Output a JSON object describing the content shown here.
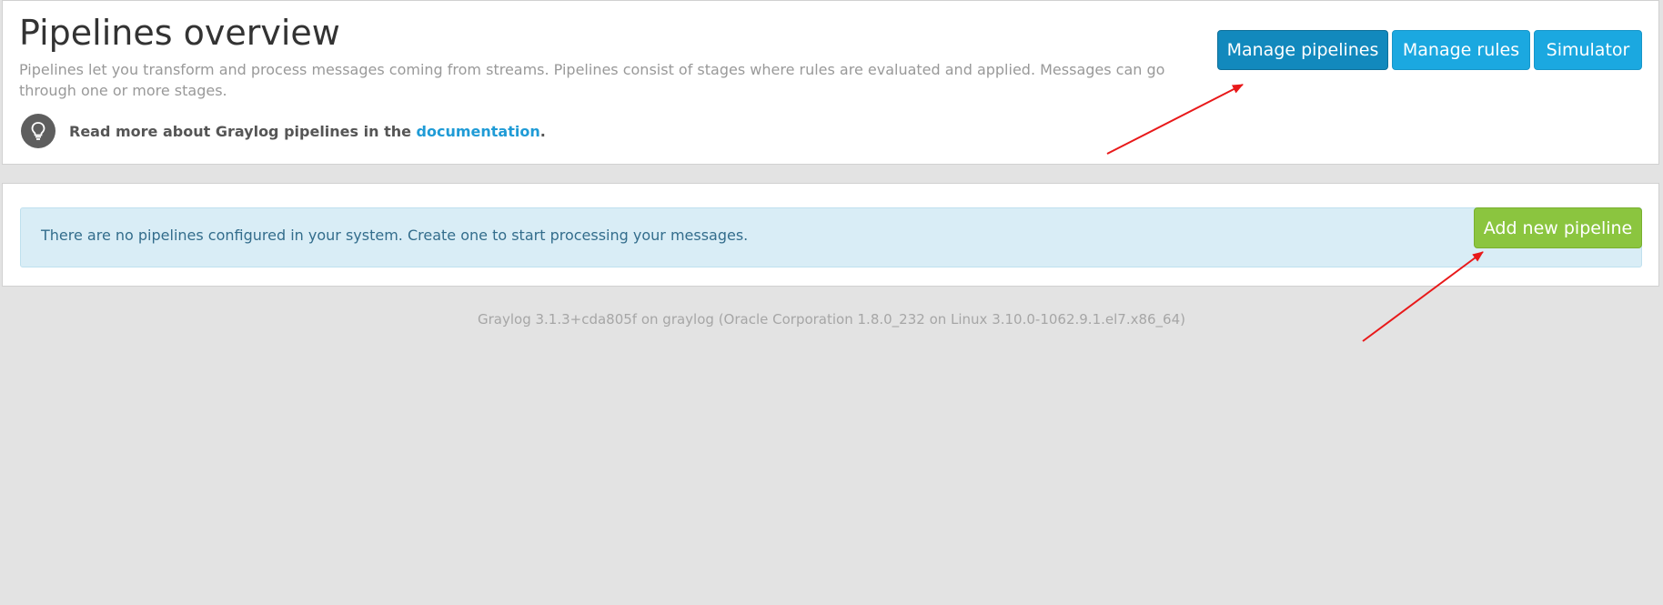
{
  "header": {
    "title": "Pipelines overview",
    "description": "Pipelines let you transform and process messages coming from streams. Pipelines consist of stages where rules are evaluated and applied. Messages can go through one or more stages.",
    "doc_prefix": "Read more about Graylog pipelines in the ",
    "doc_link": "documentation",
    "doc_suffix": ".",
    "doc_icon": "lightbulb-icon"
  },
  "toolbar": {
    "manage_pipelines_label": "Manage pipelines",
    "manage_rules_label": "Manage rules",
    "simulator_label": "Simulator"
  },
  "alert": {
    "message": "There are no pipelines configured in your system. Create one to start processing your messages.",
    "add_button_label": "Add new pipeline"
  },
  "footer": {
    "version_text": "Graylog 3.1.3+cda805f on graylog (Oracle Corporation 1.8.0_232 on Linux 3.10.0-1062.9.1.el7.x86_64)"
  },
  "colors": {
    "primary_active": "#1289bd",
    "info": "#1ba8e0",
    "success": "#8bc53f",
    "alert_bg": "#d9edf6",
    "annotation_arrow": "#e8191a"
  }
}
